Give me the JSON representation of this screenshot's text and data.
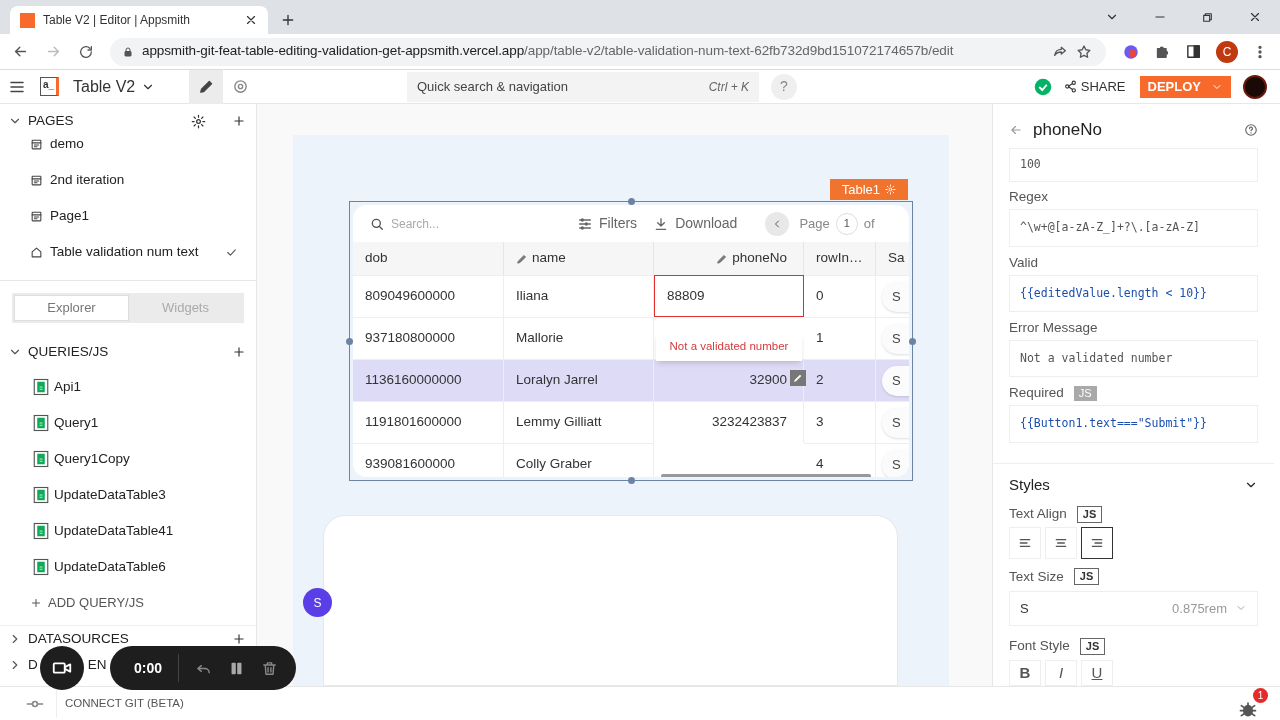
{
  "browser": {
    "tab_title": "Table V2 | Editor | Appsmith",
    "url_host": "appsmith-git-feat-table-editing-validation-get-appsmith.vercel.app",
    "url_path": "/app/table-v2/table-validation-num-text-62fb732d9bd151072174657b/edit",
    "profile_initial": "C"
  },
  "header": {
    "logo": "a_",
    "app_name": "Table V2",
    "modes": [
      {
        "kind": "edit",
        "selected": true
      },
      {
        "kind": "preview",
        "selected": false
      }
    ],
    "search_placeholder": "Quick search & navigation",
    "shortcut": "Ctrl + K",
    "help": "?",
    "share": "SHARE",
    "deploy": "DEPLOY"
  },
  "sidebar": {
    "pages": {
      "title": "PAGES",
      "expanded": true,
      "items": [
        {
          "label": "demo",
          "kind": "page",
          "current": false
        },
        {
          "label": "2nd iteration",
          "kind": "page",
          "current": false
        },
        {
          "label": "Page1",
          "kind": "page",
          "current": false
        },
        {
          "label": "Table validation num text",
          "kind": "home",
          "current": true
        }
      ]
    },
    "switcher": [
      {
        "label": "Explorer",
        "selected": true
      },
      {
        "label": "Widgets",
        "selected": false
      }
    ],
    "queries": {
      "title": "QUERIES/JS",
      "expanded": true,
      "items": [
        "Api1",
        "Query1",
        "Query1Copy",
        "UpdateDataTable3",
        "UpdateDataTable41",
        "UpdateDataTable6"
      ],
      "add": "ADD QUERY/JS"
    },
    "datasources": {
      "title": "DATASOURCES",
      "expanded": false
    },
    "dependencies": {
      "title_parts": [
        "D",
        "EN"
      ],
      "expanded": false
    }
  },
  "canvas": {
    "widget_label": "Table1",
    "avatar": "S",
    "table": {
      "search_placeholder": "Search...",
      "filters": "Filters",
      "download": "Download",
      "page_label": "Page",
      "page": "1",
      "of": "of",
      "columns": [
        {
          "label": "dob",
          "editable": false,
          "right_aligned": false
        },
        {
          "label": "name",
          "editable": true,
          "right_aligned": false
        },
        {
          "label": "phoneNo",
          "editable": true,
          "right_aligned": true
        },
        {
          "label": "rowIn…",
          "editable": false,
          "right_aligned": false
        },
        {
          "label": "Sa",
          "editable": false,
          "right_aligned": false
        }
      ],
      "rows": [
        {
          "cells": [
            "809049600000",
            "Iliana",
            "88809",
            "0",
            "S"
          ],
          "selected": false,
          "editing": true
        },
        {
          "cells": [
            "937180800000",
            "Mallorie",
            null,
            "1",
            "S"
          ],
          "selected": false,
          "editing": false
        },
        {
          "cells": [
            "1136160000000",
            "Loralyn Jarrel",
            "32900",
            "2",
            "S"
          ],
          "selected": true,
          "editing": false
        },
        {
          "cells": [
            "1191801600000",
            "Lemmy Gilliatt",
            "3232423837",
            "3",
            "S"
          ],
          "selected": false,
          "editing": false
        },
        {
          "cells": [
            "939081600000",
            "Colly Graber",
            null,
            "4",
            "S"
          ],
          "selected": false,
          "editing": false
        }
      ],
      "error_tooltip": "Not a validated number"
    }
  },
  "property_pane": {
    "title": "phoneNo",
    "fields": [
      {
        "value": "100",
        "kind": "text"
      },
      {
        "label": "Regex",
        "value": "^\\w+@[a-zA-Z_]+?\\.[a-zA-Z]",
        "kind": "text"
      },
      {
        "label": "Valid",
        "value": "{{editedValue.length < 10}}",
        "kind": "code"
      },
      {
        "label": "Error Message",
        "value": "Not a validated number",
        "kind": "text"
      },
      {
        "label": "Required",
        "badge": {
          "text": "JS",
          "active": true
        },
        "value": "{{Button1.text===\"Submit\"}}",
        "kind": "code"
      }
    ],
    "styles": {
      "title": "Styles",
      "expanded": true,
      "text_align": {
        "label": "Text Align",
        "badge": {
          "text": "JS",
          "active": false
        },
        "options": [
          {
            "kind": "left",
            "selected": false
          },
          {
            "kind": "center",
            "selected": false
          },
          {
            "kind": "right",
            "selected": true
          }
        ]
      },
      "text_size": {
        "label": "Text Size",
        "badge": {
          "text": "JS",
          "active": false
        },
        "value": "S",
        "hint": "0.875rem"
      },
      "font_style": {
        "label": "Font Style",
        "badge": {
          "text": "JS",
          "active": false
        },
        "options": [
          "B",
          "I",
          "U"
        ]
      }
    }
  },
  "status_bar": {
    "git": "CONNECT GIT (BETA)",
    "error_count": "1"
  },
  "recorder": {
    "time": "0:00"
  }
}
